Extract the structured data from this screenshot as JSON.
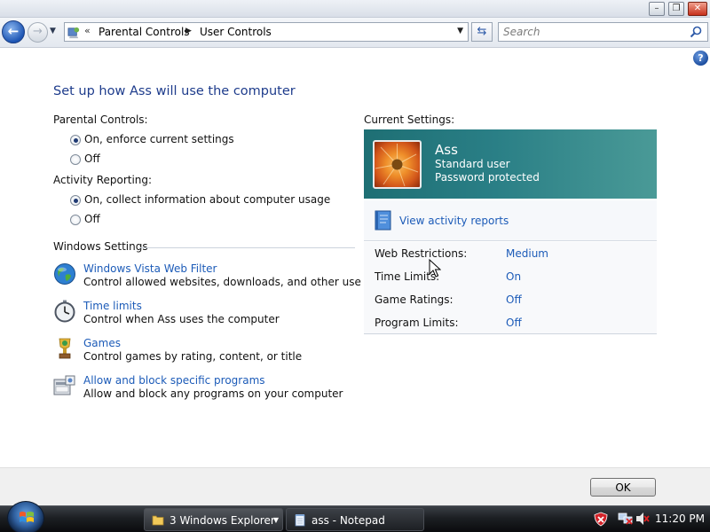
{
  "window": {
    "controls": {
      "minimize": "–",
      "maximize": "❐",
      "close": "✕"
    }
  },
  "navigation": {
    "back_icon": "back-arrow",
    "forward_icon": "forward-arrow",
    "breadcrumb": [
      "Parental Controls",
      "User Controls"
    ],
    "search_placeholder": "Search"
  },
  "main": {
    "title": "Set up how Ass will use the computer",
    "parental_controls": {
      "label": "Parental Controls:",
      "options": [
        {
          "label": "On, enforce current settings",
          "selected": true
        },
        {
          "label": "Off",
          "selected": false
        }
      ]
    },
    "activity_reporting": {
      "label": "Activity Reporting:",
      "options": [
        {
          "label": "On, collect information about computer usage",
          "selected": true
        },
        {
          "label": "Off",
          "selected": false
        }
      ]
    },
    "windows_settings": {
      "heading": "Windows Settings",
      "items": [
        {
          "title": "Windows Vista Web Filter",
          "description": "Control allowed websites, downloads, and other use",
          "icon": "globe-icon"
        },
        {
          "title": "Time limits",
          "description": "Control when Ass uses the computer",
          "icon": "clock-icon"
        },
        {
          "title": "Games",
          "description": "Control games by rating, content, or title",
          "icon": "trophy-icon"
        },
        {
          "title": "Allow and block specific programs",
          "description": "Allow and block any programs on your computer",
          "icon": "programs-icon"
        }
      ]
    }
  },
  "current_settings": {
    "heading": "Current Settings:",
    "user": {
      "name": "Ass",
      "account_type": "Standard user",
      "password_status": "Password protected",
      "card_color": "#2a7f86"
    },
    "activity_reports_link": "View activity reports",
    "restrictions": [
      {
        "label": "Web Restrictions:",
        "value": "Medium"
      },
      {
        "label": "Time Limits:",
        "value": "On"
      },
      {
        "label": "Game Ratings:",
        "value": "Off"
      },
      {
        "label": "Program Limits:",
        "value": "Off"
      }
    ]
  },
  "footer": {
    "ok_label": "OK"
  },
  "taskbar": {
    "tasks": [
      {
        "label": "3 Windows Explorer",
        "active": true
      },
      {
        "label": "ass - Notepad",
        "active": false
      }
    ],
    "clock": "11:20 PM"
  },
  "colors": {
    "title": "#1e3c8c",
    "link": "#1c5bb8",
    "user_card": "#2a7f86"
  }
}
